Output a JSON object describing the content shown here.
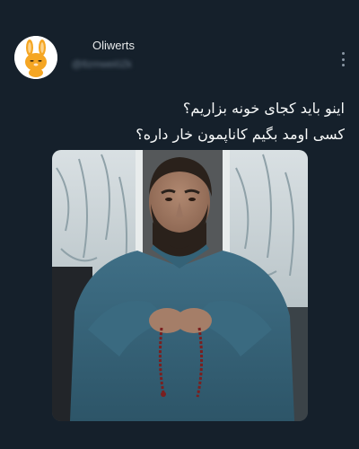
{
  "tweet": {
    "display_name": "Oliwerts",
    "handle": "@8zmwei0Zk",
    "text_lines": [
      "اینو باید کجای خونه بزاریم؟",
      "کسی اومد بگیم کاناپمون خار داره؟"
    ],
    "more_icon": "more-vertical-icon",
    "avatar_icon": "rabbit-icon"
  },
  "colors": {
    "background": "#15202b",
    "text": "#f7f9f9",
    "avatar_orange": "#f5a623"
  }
}
